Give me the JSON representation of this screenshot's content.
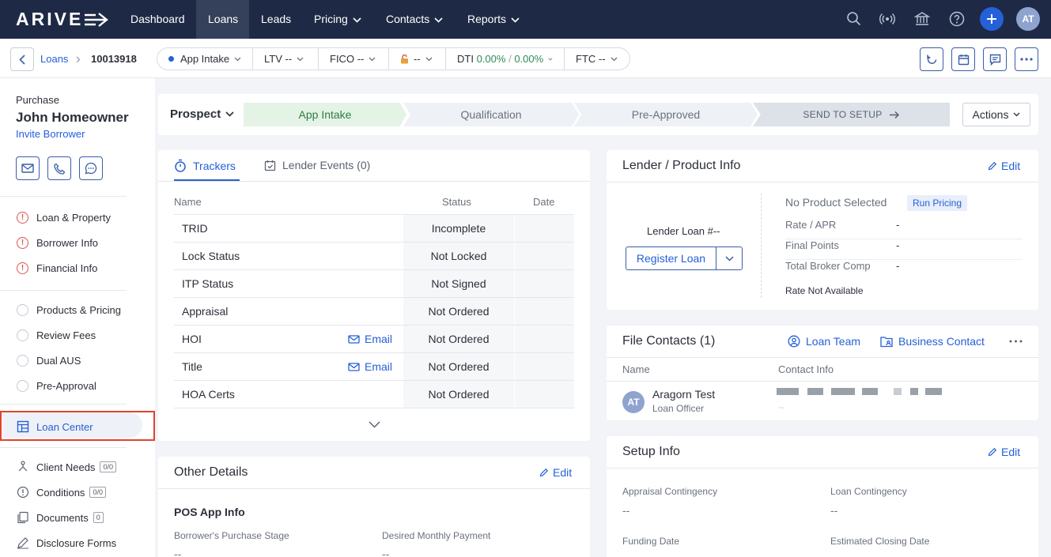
{
  "app": {
    "logo": "ARIVE"
  },
  "nav": {
    "items": [
      "Dashboard",
      "Loans",
      "Leads",
      "Pricing",
      "Contacts",
      "Reports"
    ],
    "user_initials": "AT"
  },
  "subbar": {
    "breadcrumb": {
      "root": "Loans",
      "loan_id": "10013918"
    },
    "pills": {
      "stage": "App Intake",
      "ltv_label": "LTV",
      "ltv_value": "--",
      "fico_label": "FICO",
      "fico_value": "--",
      "lock_value": "--",
      "dti_label": "DTI",
      "dti_front": "0.00%",
      "dti_sep": "/",
      "dti_back": "0.00%",
      "ftc_label": "FTC",
      "ftc_value": "--"
    }
  },
  "sidebar": {
    "loan_type": "Purchase",
    "borrower": "John Homeowner",
    "invite": "Invite Borrower",
    "group1": [
      "Loan & Property",
      "Borrower Info",
      "Financial Info"
    ],
    "group2": [
      "Products & Pricing",
      "Review Fees",
      "Dual AUS",
      "Pre-Approval"
    ],
    "loan_center": "Loan Center",
    "group3": [
      {
        "label": "Client Needs",
        "badge": "0/0"
      },
      {
        "label": "Conditions",
        "badge": "0/0"
      },
      {
        "label": "Documents",
        "badge": "0"
      },
      {
        "label": "Disclosure Forms"
      }
    ]
  },
  "stages": {
    "prospect": "Prospect",
    "steps": [
      "App Intake",
      "Qualification",
      "Pre-Approved",
      "SEND TO SETUP"
    ],
    "actions": "Actions"
  },
  "trackers": {
    "tabs": [
      "Trackers",
      "Lender Events (0)"
    ],
    "headers": {
      "name": "Name",
      "status": "Status",
      "date": "Date"
    },
    "rows": [
      {
        "name": "TRID",
        "status": "Incomplete"
      },
      {
        "name": "Lock Status",
        "status": "Not Locked"
      },
      {
        "name": "ITP Status",
        "status": "Not Signed"
      },
      {
        "name": "Appraisal",
        "status": "Not Ordered"
      },
      {
        "name": "HOI",
        "status": "Not Ordered",
        "email": "Email"
      },
      {
        "name": "Title",
        "status": "Not Ordered",
        "email": "Email"
      },
      {
        "name": "HOA Certs",
        "status": "Not Ordered"
      }
    ]
  },
  "other": {
    "title": "Other Details",
    "edit": "Edit",
    "section": "POS App Info",
    "f1_label": "Borrower's Purchase Stage",
    "f1_value": "--",
    "f2_label": "Desired Monthly Payment",
    "f2_value": "--"
  },
  "lender": {
    "title": "Lender / Product Info",
    "edit": "Edit",
    "loan_num": "Lender Loan #--",
    "register": "Register Loan",
    "no_product": "No Product Selected",
    "run_pricing": "Run Pricing",
    "rows": [
      {
        "label": "Rate / APR",
        "value": "-"
      },
      {
        "label": "Final Points",
        "value": "-"
      },
      {
        "label": "Total Broker Comp",
        "value": "-"
      }
    ],
    "rate_na": "Rate Not Available"
  },
  "contacts": {
    "title": "File Contacts (1)",
    "loan_team": "Loan Team",
    "business": "Business Contact",
    "col_name": "Name",
    "col_info": "Contact Info",
    "contact_name": "Aragorn Test",
    "contact_role": "Loan Officer",
    "contact_initials": "AT",
    "contact_info2": "--"
  },
  "setup": {
    "title": "Setup Info",
    "edit": "Edit",
    "f1_label": "Appraisal Contingency",
    "f1_value": "--",
    "f2_label": "Loan Contingency",
    "f2_value": "--",
    "f3_label": "Funding Date",
    "f4_label": "Estimated Closing Date"
  }
}
